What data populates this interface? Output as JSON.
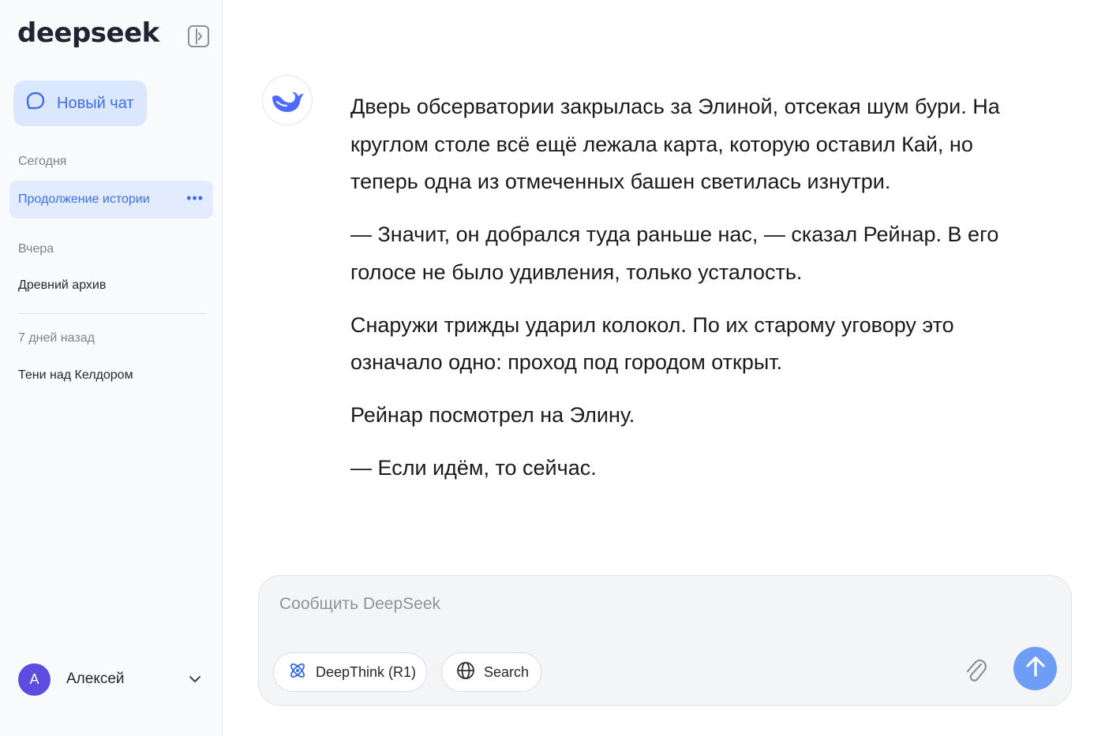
{
  "app": {
    "logo": "deepseek",
    "accent_color": "#3d6ee8",
    "send_button_color": "#6e9df5"
  },
  "sidebar": {
    "new_chat_label": "Новый чат",
    "sections": [
      {
        "label": "Сегодня",
        "items": [
          {
            "title": "Продолжение истории",
            "active": true
          }
        ]
      },
      {
        "label": "Вчера",
        "items": [
          {
            "title": "Древний архив",
            "active": false
          }
        ]
      },
      {
        "label": "7 дней назад",
        "items": [
          {
            "title": "Тени над Келдором",
            "active": false
          }
        ]
      }
    ],
    "more_icon": "ellipsis-icon",
    "user": {
      "initial": "А",
      "name": "Алексей"
    }
  },
  "message": {
    "paragraphs": [
      "Дверь обсерватории закрылась за Элиной, отсекая шум бури. На круглом столе всё ещё лежала карта, которую оставил Кай, но теперь одна из отмеченных башен светилась изнутри.",
      "— Значит, он добрался туда раньше нас, — сказал Рейнар. В его голосе не было удивления, только усталость.",
      "Снаружи трижды ударил колокол. По их старому уговору это означало одно: проход под городом открыт.",
      "Рейнар посмотрел на Элину.",
      "— Если идём, то сейчас."
    ]
  },
  "composer": {
    "placeholder": "Сообщить DeepSeek",
    "deepthink_label": "DeepThink (R1)",
    "search_label": "Search"
  }
}
